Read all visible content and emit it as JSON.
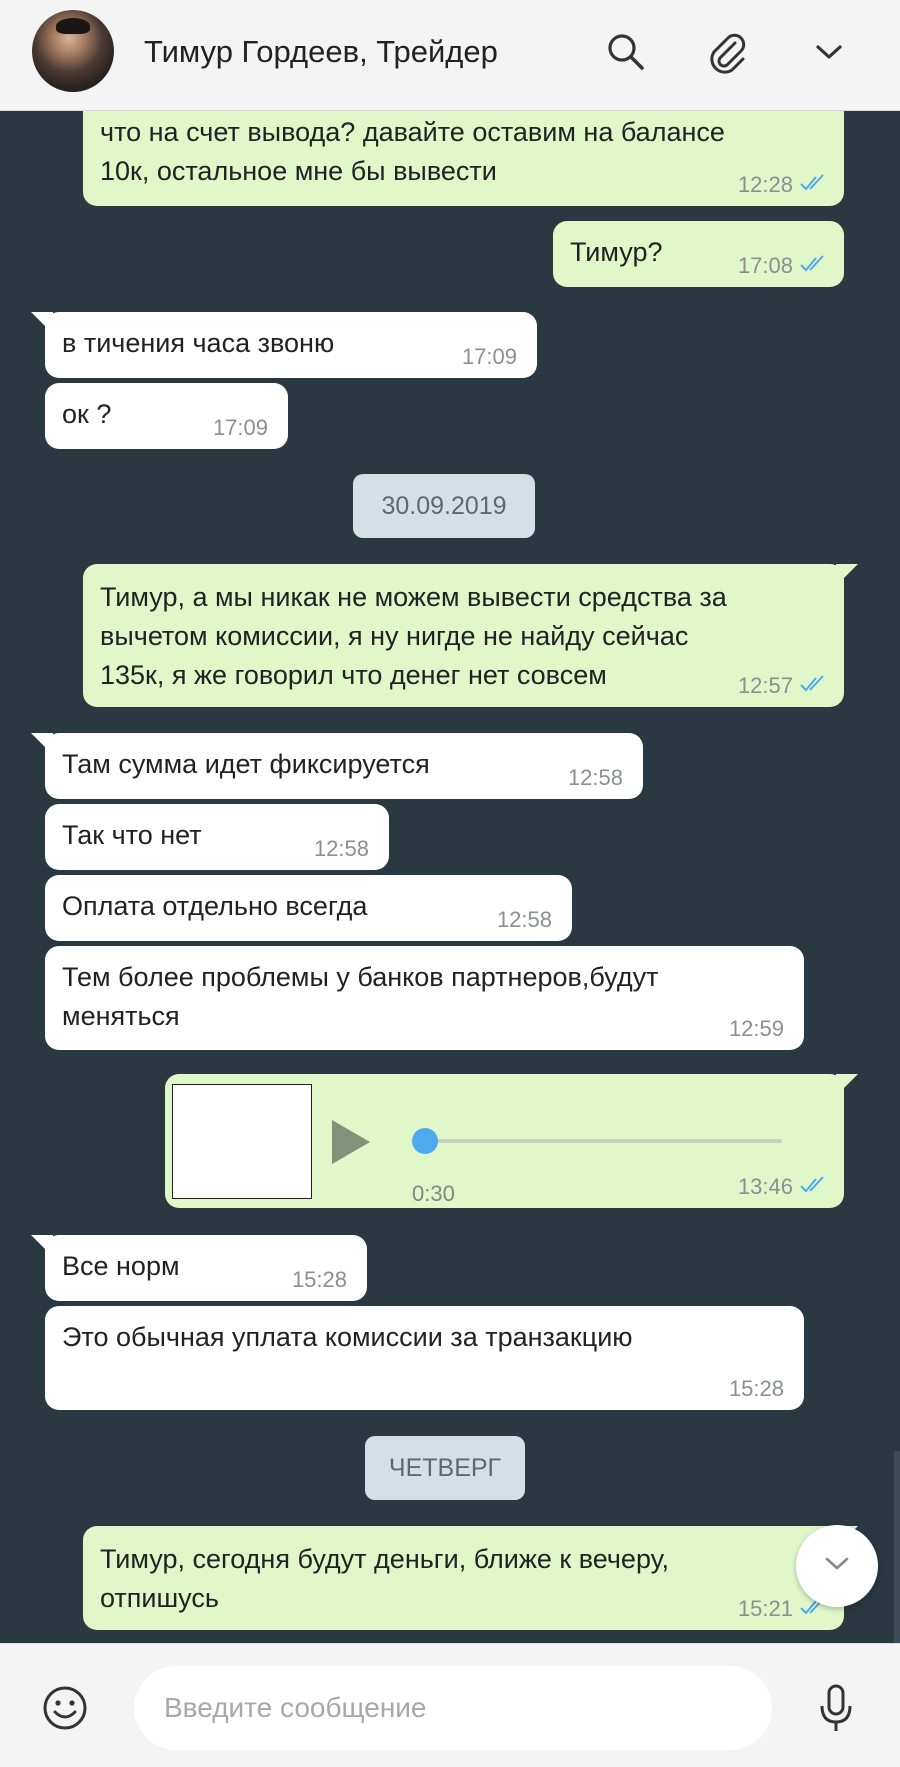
{
  "header": {
    "title": "Тимур Гордеев, Трейдер"
  },
  "messages": [
    {
      "text": "что на счет вывода? давайте оставим на балансе\n10к, остальное мне бы вывести",
      "time": "12:28"
    },
    {
      "text": "Тимур?",
      "time": "17:08"
    },
    {
      "text": "в тичения часа звоню",
      "time": "17:09"
    },
    {
      "text": "ок ?",
      "time": "17:09"
    },
    {
      "text": "Тимур, а мы никак не можем вывести средства за\nвычетом комиссии, я ну нигде не найду сейчас\n135к, я же говорил что денег нет совсем",
      "time": "12:57"
    },
    {
      "text": "Там сумма идет фиксируется",
      "time": "12:58"
    },
    {
      "text": "Так что нет",
      "time": "12:58"
    },
    {
      "text": "Оплата отдельно всегда",
      "time": "12:58"
    },
    {
      "text": "Тем более проблемы у банков партнеров,будут\nменяться",
      "time": "12:59"
    },
    {
      "text": "Все норм",
      "time": "15:28"
    },
    {
      "text": "Это обычная уплата комиссии за транзакцию",
      "time": "15:28"
    },
    {
      "text": "Тимур, сегодня будут деньги, ближе к вечеру,\nотпишусь",
      "time": "15:21"
    }
  ],
  "dates": {
    "d1": "30.09.2019",
    "d2": "ЧЕТВЕРГ"
  },
  "voice": {
    "duration": "0:30",
    "time": "13:46",
    "progress": 0
  },
  "composer": {
    "placeholder": "Введите сообщение"
  },
  "colors": {
    "outgoing_bubble": "#dff7c9",
    "incoming_bubble": "#ffffff",
    "chat_background": "#2a3841",
    "read_ticks": "#4ea9ee"
  },
  "icons": {
    "search": "search-icon",
    "attach": "paperclip-icon",
    "menu": "chevron-down-icon",
    "emoji": "emoji-icon",
    "mic": "microphone-icon",
    "scroll": "chevron-down-icon"
  }
}
